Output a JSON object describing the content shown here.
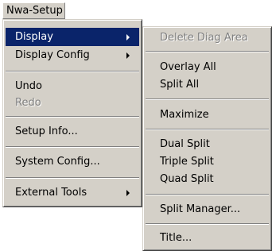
{
  "menubar": {
    "title": "Nwa-Setup"
  },
  "main_menu": {
    "items": [
      {
        "label": "Display"
      },
      {
        "label": "Display Config"
      },
      {
        "label": "Undo"
      },
      {
        "label": "Redo"
      },
      {
        "label": "Setup Info..."
      },
      {
        "label": "System Config..."
      },
      {
        "label": "External Tools"
      }
    ]
  },
  "display_submenu": {
    "items": [
      {
        "label": "Delete Diag Area"
      },
      {
        "label": "Overlay All"
      },
      {
        "label": "Split All"
      },
      {
        "label": "Maximize"
      },
      {
        "label": "Dual Split"
      },
      {
        "label": "Triple Split"
      },
      {
        "label": "Quad Split"
      },
      {
        "label": "Split Manager..."
      },
      {
        "label": "Title..."
      }
    ]
  },
  "colors": {
    "menu_bg": "#d4d0c8",
    "highlight_bg": "#0a246a",
    "disabled_text": "#808080"
  }
}
